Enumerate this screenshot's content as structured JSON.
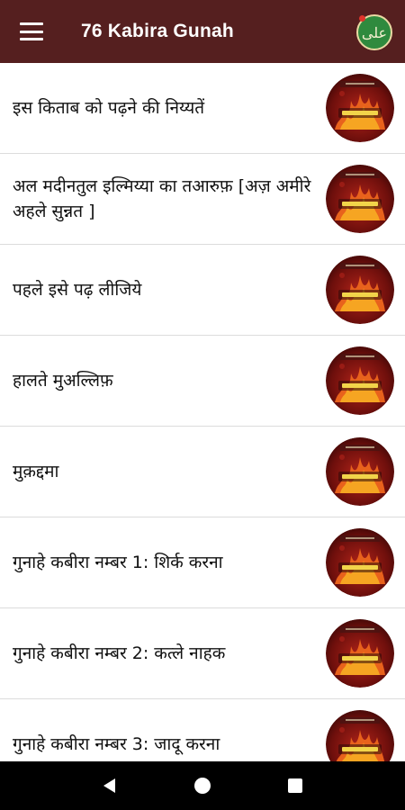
{
  "app_bar": {
    "title": "76 Kabira Gunah",
    "menu_icon": "hamburger-menu-icon",
    "badge_icon": "ali-calligraphy-icon",
    "badge_glyph": "علی",
    "background": "#551f1f"
  },
  "list": {
    "thumbnail_icon": "book-cover-thumbnail",
    "items": [
      {
        "title": "इस किताब को पढ़ने की निय्यतें"
      },
      {
        "title": "अल मदीनतुल इल्मिय्या का तआरुफ़ [अज़ अमीरे अहले सुन्नत ]"
      },
      {
        "title": "पहले इसे पढ़ लीजिये"
      },
      {
        "title": "हालते मुअल्लिफ़"
      },
      {
        "title": "मुक़द्दमा"
      },
      {
        "title": "गुनाहे कबीरा नम्बर 1: शिर्क करना"
      },
      {
        "title": "गुनाहे कबीरा नम्बर 2: कत्ले नाहक"
      },
      {
        "title": "गुनाहे कबीरा नम्बर 3: जादू करना"
      }
    ]
  },
  "nav_bar": {
    "back_icon": "back-triangle-icon",
    "home_icon": "home-circle-icon",
    "recents_icon": "recents-square-icon"
  }
}
